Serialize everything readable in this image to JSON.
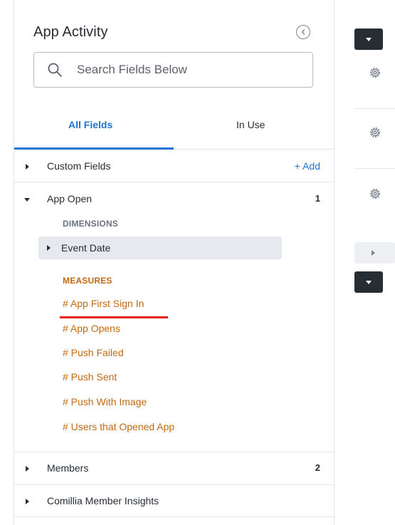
{
  "panel": {
    "title": "App Activity",
    "search": {
      "placeholder": "Search Fields Below",
      "value": ""
    },
    "tabs": [
      {
        "label": "All Fields",
        "active": true
      },
      {
        "label": "In Use",
        "active": false
      }
    ],
    "groups": {
      "custom_fields": {
        "label": "Custom Fields",
        "action": "+ Add"
      },
      "app_open": {
        "label": "App Open",
        "count": "1",
        "dimensions_heading": "DIMENSIONS",
        "dimensions": [
          "Event Date"
        ],
        "measures_heading": "MEASURES",
        "measures": [
          "# App First Sign In",
          "# App Opens",
          "# Push Failed",
          "# Push Sent",
          "# Push With Image",
          "# Users that Opened App"
        ]
      },
      "members": {
        "label": "Members",
        "count": "2"
      },
      "comillia_member_insights": {
        "label": "Comillia Member Insights"
      }
    }
  },
  "colors": {
    "accent_blue": "#1f74d0",
    "measure_orange": "#c26a11",
    "highlight_red": "#e8231b",
    "dark_button": "#262d33"
  },
  "icons": {
    "collapse": "chevron-left-circle-icon",
    "search": "magnifier-icon",
    "settings": "gear-icon"
  }
}
